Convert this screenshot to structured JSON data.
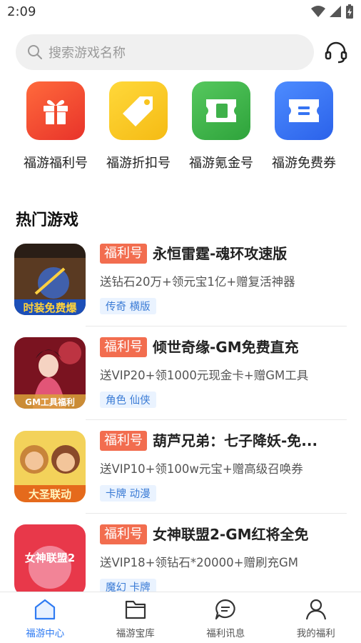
{
  "status_bar": {
    "time": "2:09"
  },
  "search": {
    "placeholder": "搜索游戏名称"
  },
  "categories": [
    {
      "label": "福游福利号",
      "icon": "gift-icon",
      "color": "#f04a2d"
    },
    {
      "label": "福游折扣号",
      "icon": "price-tag-icon",
      "color": "#f8c41f"
    },
    {
      "label": "福游氪金号",
      "icon": "ticket-icon",
      "color": "#3fb14a"
    },
    {
      "label": "福游免费券",
      "icon": "coupon-icon",
      "color": "#3573f2"
    }
  ],
  "section": {
    "title": "热门游戏"
  },
  "games": [
    {
      "tag": "福利号",
      "title": "永恒雷霆-魂环攻速版",
      "desc": "送钻石20万+领元宝1亿+赠复活神器",
      "tags": "传奇 横版"
    },
    {
      "tag": "福利号",
      "title": "倾世奇缘-GM免费直充",
      "desc": "送VIP20+领1000元现金卡+赠GM工具",
      "tags": "角色 仙侠"
    },
    {
      "tag": "福利号",
      "title": "葫芦兄弟：七子降妖-免...",
      "desc": "送VIP10+领100w元宝+赠高级召唤券",
      "tags": "卡牌 动漫"
    },
    {
      "tag": "福利号",
      "title": "女神联盟2-GM红将全免",
      "desc": "送VIP18+领钻石*20000+赠刷充GM",
      "tags": "魔幻 卡牌"
    }
  ],
  "tabs": [
    {
      "label": "福游中心",
      "icon": "home-icon",
      "active": true
    },
    {
      "label": "福游宝库",
      "icon": "folder-icon",
      "active": false
    },
    {
      "label": "福利讯息",
      "icon": "chat-icon",
      "active": false
    },
    {
      "label": "我的福利",
      "icon": "user-icon",
      "active": false
    }
  ],
  "colors": {
    "accent": "#2f7bf2",
    "tag_bg": "#f26d4f",
    "genre_tag_bg": "#eaf3ff",
    "genre_tag_text": "#3a7bd5"
  }
}
